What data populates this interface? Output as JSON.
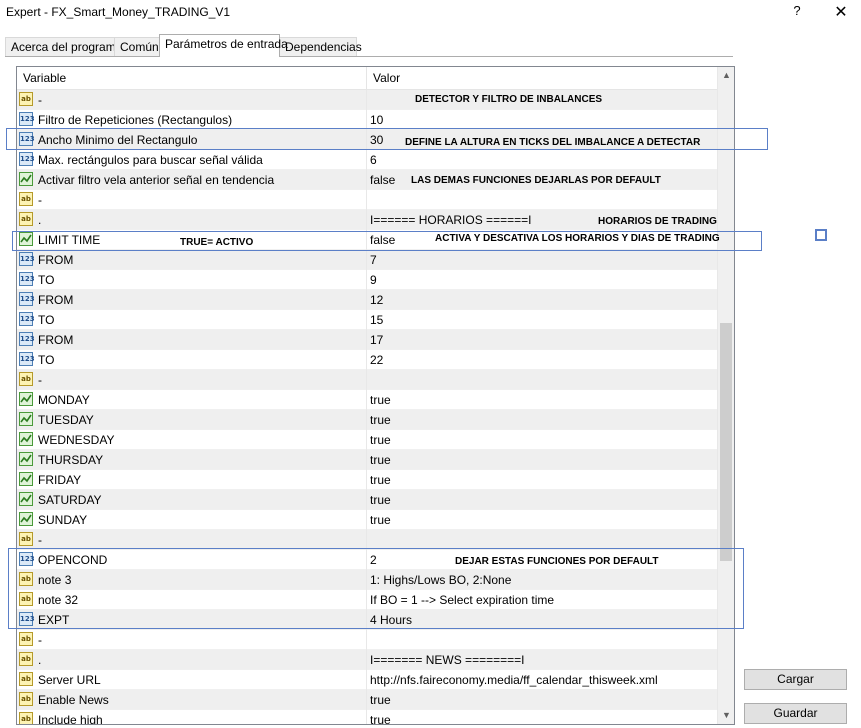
{
  "window": {
    "title": "Expert - FX_Smart_Money_TRADING_V1",
    "help": "?",
    "close": "✕"
  },
  "tabs": [
    {
      "label": "Acerca del programa"
    },
    {
      "label": "Común"
    },
    {
      "label": "Parámetros de entrada"
    },
    {
      "label": "Dependencias"
    }
  ],
  "grid": {
    "col_variable": "Variable",
    "col_value": "Valor",
    "rows": [
      {
        "type": "ab",
        "name": "-",
        "value": ""
      },
      {
        "type": "num",
        "name": "Filtro de Repeticiones (Rectangulos)",
        "value": "10"
      },
      {
        "type": "num",
        "name": "Ancho Minimo del Rectangulo",
        "value": "30"
      },
      {
        "type": "num",
        "name": "Max. rectángulos para buscar señal válida",
        "value": "6"
      },
      {
        "type": "bool",
        "name": "Activar filtro vela anterior señal en tendencia",
        "value": "false"
      },
      {
        "type": "ab",
        "name": "-",
        "value": ""
      },
      {
        "type": "ab",
        "name": ".",
        "value": "I====== HORARIOS ======I"
      },
      {
        "type": "bool",
        "name": "LIMIT TIME",
        "value": "false"
      },
      {
        "type": "num",
        "name": "FROM",
        "value": "7"
      },
      {
        "type": "num",
        "name": "TO",
        "value": "9"
      },
      {
        "type": "num",
        "name": "FROM",
        "value": "12"
      },
      {
        "type": "num",
        "name": "TO",
        "value": "15"
      },
      {
        "type": "num",
        "name": "FROM",
        "value": "17"
      },
      {
        "type": "num",
        "name": "TO",
        "value": "22"
      },
      {
        "type": "ab",
        "name": "-",
        "value": ""
      },
      {
        "type": "bool",
        "name": "MONDAY",
        "value": "true"
      },
      {
        "type": "bool",
        "name": "TUESDAY",
        "value": "true"
      },
      {
        "type": "bool",
        "name": "WEDNESDAY",
        "value": "true"
      },
      {
        "type": "bool",
        "name": "THURSDAY",
        "value": "true"
      },
      {
        "type": "bool",
        "name": "FRIDAY",
        "value": "true"
      },
      {
        "type": "bool",
        "name": "SATURDAY",
        "value": "true"
      },
      {
        "type": "bool",
        "name": "SUNDAY",
        "value": "true"
      },
      {
        "type": "ab",
        "name": "-",
        "value": ""
      },
      {
        "type": "num",
        "name": "OPENCOND",
        "value": "2"
      },
      {
        "type": "ab",
        "name": "note 3",
        "value": "1: Highs/Lows BO, 2:None"
      },
      {
        "type": "ab",
        "name": "note 32",
        "value": "If BO = 1 --> Select expiration time"
      },
      {
        "type": "num",
        "name": "EXPT",
        "value": "4 Hours"
      },
      {
        "type": "ab",
        "name": "-",
        "value": ""
      },
      {
        "type": "ab",
        "name": ".",
        "value": "I======= NEWS ========I"
      },
      {
        "type": "ab",
        "name": "Server URL",
        "value": "http://nfs.faireconomy.media/ff_calendar_thisweek.xml"
      },
      {
        "type": "ab",
        "name": "Enable News",
        "value": "true"
      },
      {
        "type": "ab",
        "name": "Include high",
        "value": "true"
      }
    ]
  },
  "icons": {
    "ab": "ab",
    "num": "123",
    "bool": "bool-check-icon"
  },
  "annotations": {
    "detector": "DETECTOR Y FILTRO DE INBALANCES",
    "define": "DEFINE LA ALTURA EN TICKS DEL IMBALANCE A DETECTAR",
    "defaults": "LAS DEMAS FUNCIONES DEJARLAS POR DEFAULT",
    "horarios": "HORARIOS DE TRADING",
    "true_activo": "TRUE= ACTIVO",
    "activa": "ACTIVA Y DESCATIVA LOS HORARIOS Y DIAS DE TRADING",
    "dejar": "DEJAR ESTAS FUNCIONES POR DEFAULT"
  },
  "buttons": {
    "load": "Cargar",
    "save": "Guardar"
  },
  "colors": {
    "highlight": "#5b7fc7",
    "alt_row": "#efefef"
  }
}
